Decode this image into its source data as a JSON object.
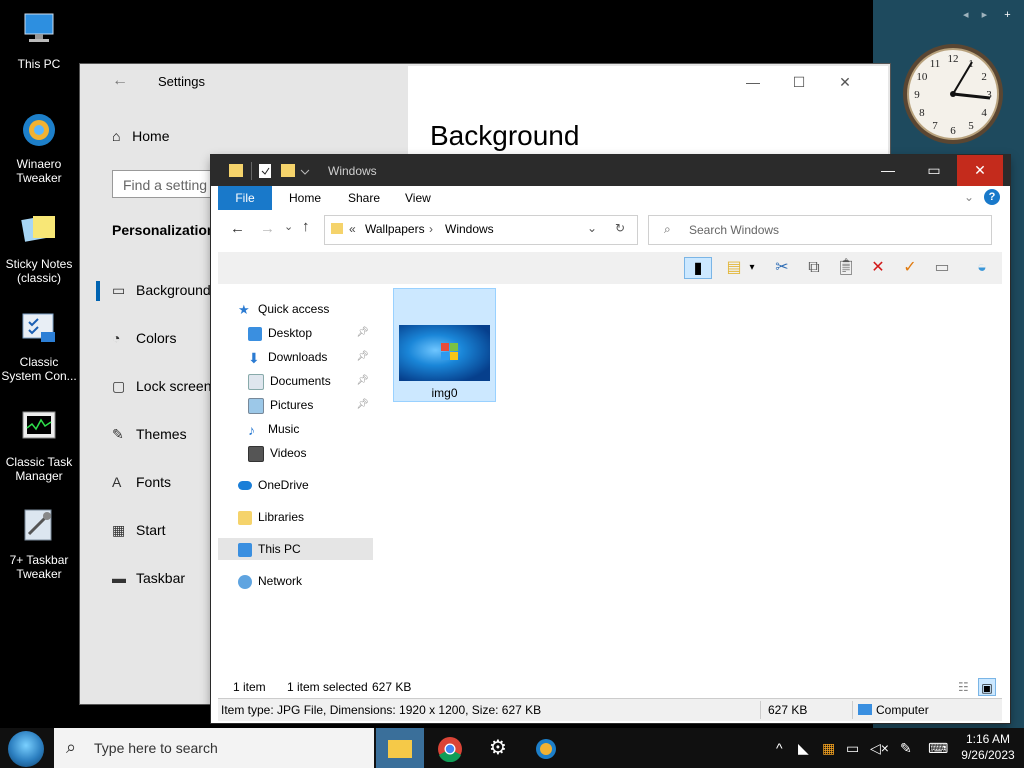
{
  "desktop": {
    "icons": [
      {
        "label": "This PC"
      },
      {
        "label": "Winaero\nTweaker"
      },
      {
        "label": "Sticky Notes\n(classic)"
      },
      {
        "label": "Classic\nSystem Con..."
      },
      {
        "label": "Classic Task\nManager"
      },
      {
        "label": "7+ Taskbar\nTweaker"
      }
    ],
    "widget_controls": {
      "prev": "◂",
      "next": "▸",
      "add": "+"
    }
  },
  "settings": {
    "title": "Settings",
    "home": "Home",
    "search_placeholder": "Find a setting",
    "section": "Personalization",
    "nav": [
      {
        "label": "Background",
        "glyph": "▭"
      },
      {
        "label": "Colors",
        "glyph": "◔"
      },
      {
        "label": "Lock screen",
        "glyph": "▢"
      },
      {
        "label": "Themes",
        "glyph": "✎"
      },
      {
        "label": "Fonts",
        "glyph": "A"
      },
      {
        "label": "Start",
        "glyph": "▦"
      },
      {
        "label": "Taskbar",
        "glyph": "▬"
      }
    ],
    "page_title": "Background",
    "window_buttons": {
      "minimize": "—",
      "maximize": "☐",
      "close": "✕"
    }
  },
  "explorer": {
    "title": "Windows",
    "tabs": [
      "File",
      "Home",
      "Share",
      "View"
    ],
    "breadcrumb": {
      "prefix": "«",
      "parts": [
        "Wallpapers",
        "Windows"
      ]
    },
    "search_placeholder": "Search Windows",
    "nav": [
      {
        "label": "Quick access",
        "pinned": false
      },
      {
        "label": "Desktop",
        "pinned": true
      },
      {
        "label": "Downloads",
        "pinned": true
      },
      {
        "label": "Documents",
        "pinned": true
      },
      {
        "label": "Pictures",
        "pinned": true
      },
      {
        "label": "Music",
        "pinned": false
      },
      {
        "label": "Videos",
        "pinned": false
      },
      {
        "label": "OneDrive",
        "pinned": false
      },
      {
        "label": "Libraries",
        "pinned": false
      },
      {
        "label": "This PC",
        "pinned": false
      },
      {
        "label": "Network",
        "pinned": false
      }
    ],
    "files": [
      {
        "name": "img0"
      }
    ],
    "status": {
      "count": "1 item",
      "selected": "1 item selected",
      "size": "627 KB"
    },
    "info": {
      "details": "Item type: JPG File, Dimensions: 1920 x 1200, Size: 627 KB",
      "size": "627 KB",
      "location": "Computer"
    }
  },
  "clock": {
    "numbers": [
      "12",
      "1",
      "2",
      "3",
      "4",
      "5",
      "6",
      "7",
      "8",
      "9",
      "10",
      "11"
    ]
  },
  "taskbar": {
    "search_placeholder": "Type here to search",
    "time": "1:16 AM",
    "date": "9/26/2023"
  },
  "colors": {
    "accent": "#1979ca",
    "close_red": "#c42b1c",
    "selection": "#cce8ff"
  }
}
